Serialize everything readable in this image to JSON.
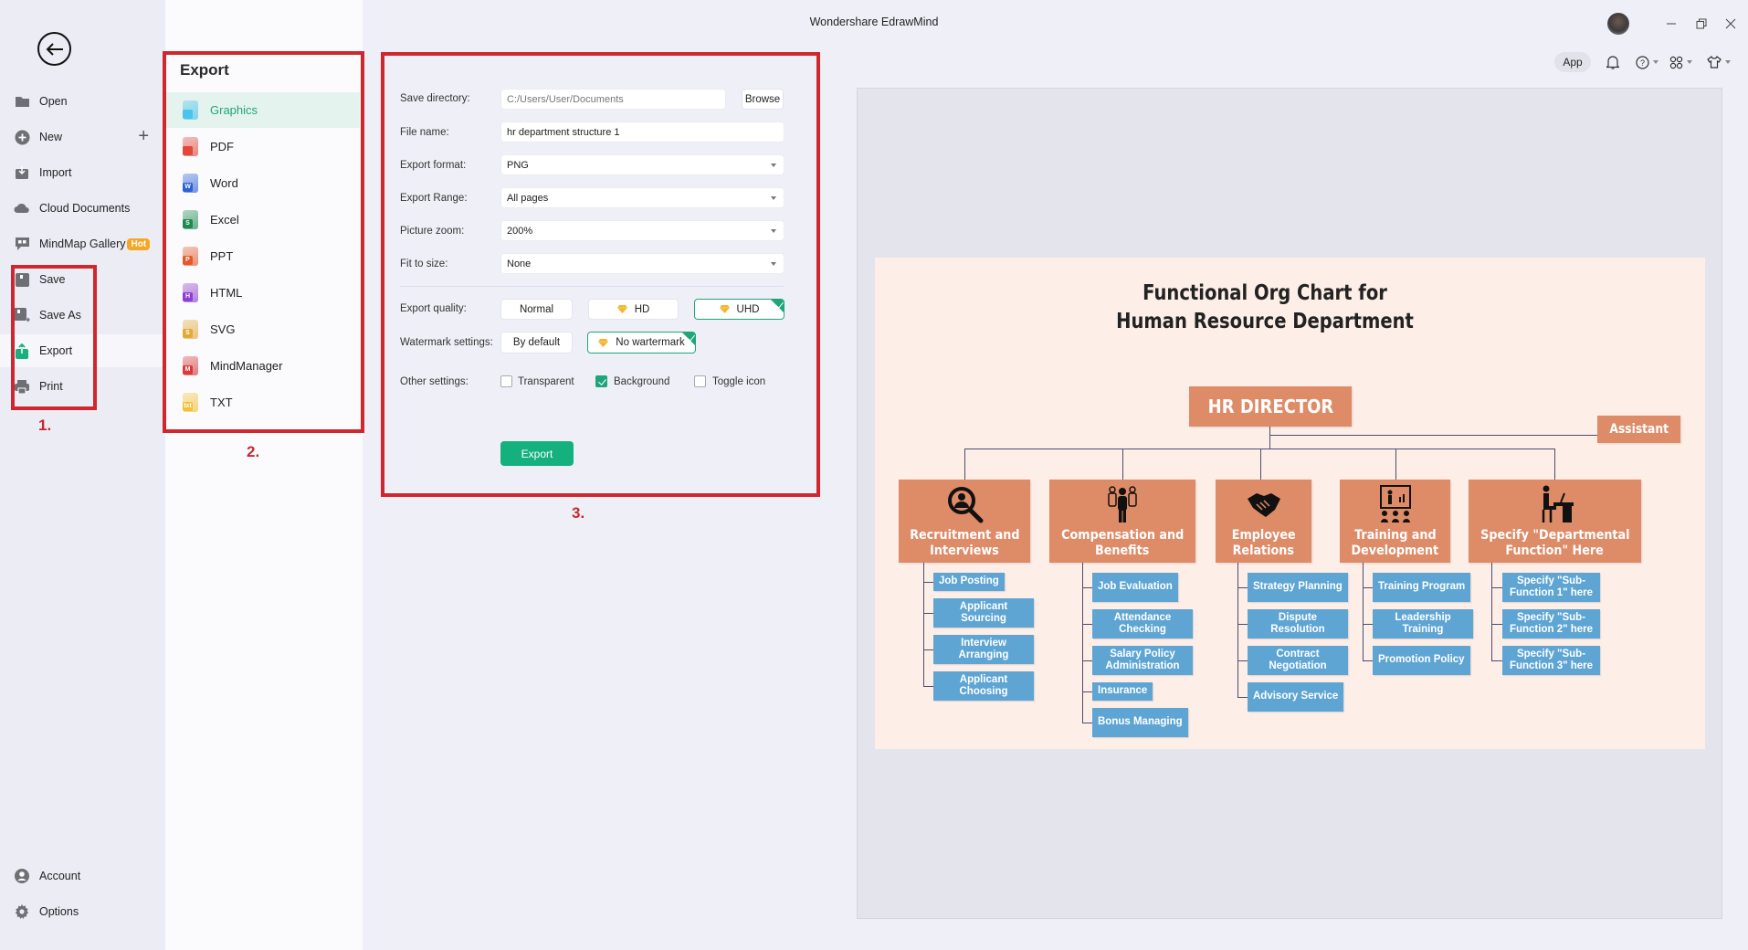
{
  "window": {
    "title": "Wondershare EdrawMind",
    "toolbar": {
      "app_label": "App"
    }
  },
  "sidebar": {
    "items": [
      {
        "label": "Open",
        "icon": "folder-icon"
      },
      {
        "label": "New",
        "icon": "plus-circle-icon"
      },
      {
        "label": "Import",
        "icon": "import-icon"
      },
      {
        "label": "Cloud Documents",
        "icon": "cloud-icon"
      },
      {
        "label": "MindMap Gallery",
        "icon": "gallery-icon",
        "badge": "Hot"
      },
      {
        "label": "Save",
        "icon": "save-icon"
      },
      {
        "label": "Save As",
        "icon": "save-as-icon"
      },
      {
        "label": "Export",
        "icon": "export-icon",
        "active": true
      },
      {
        "label": "Print",
        "icon": "print-icon"
      }
    ],
    "bottom": [
      {
        "label": "Account",
        "icon": "account-icon"
      },
      {
        "label": "Options",
        "icon": "gear-icon"
      }
    ]
  },
  "annotations": {
    "one": "1.",
    "two": "2.",
    "three": "3.",
    "accent": "#d0262e"
  },
  "export_panel": {
    "title": "Export",
    "formats": [
      {
        "label": "Graphics",
        "active": true,
        "color": "#4cc3ea",
        "glyph": ""
      },
      {
        "label": "PDF",
        "color": "#e2473a",
        "glyph": ""
      },
      {
        "label": "Word",
        "color": "#2d62d4",
        "glyph": "W"
      },
      {
        "label": "Excel",
        "color": "#1d8b50",
        "glyph": "S"
      },
      {
        "label": "PPT",
        "color": "#e55a2b",
        "glyph": "P"
      },
      {
        "label": "HTML",
        "color": "#8d3fd0",
        "glyph": "H"
      },
      {
        "label": "SVG",
        "color": "#e2a93b",
        "glyph": "S"
      },
      {
        "label": "MindManager",
        "color": "#d83a3a",
        "glyph": "M"
      },
      {
        "label": "TXT",
        "color": "#f2c13a",
        "glyph": "txt"
      }
    ]
  },
  "settings": {
    "save_directory": {
      "label": "Save directory:",
      "value": "C:/Users/User/Documents",
      "browse": "Browse"
    },
    "file_name": {
      "label": "File name:",
      "value": "hr department structure 1"
    },
    "export_format": {
      "label": "Export format:",
      "value": "PNG"
    },
    "export_range": {
      "label": "Export Range:",
      "value": "All pages"
    },
    "picture_zoom": {
      "label": "Picture zoom:",
      "value": "200%"
    },
    "fit_to_size": {
      "label": "Fit to size:",
      "value": "None"
    },
    "export_quality": {
      "label": "Export quality:",
      "options": [
        "Normal",
        "HD",
        "UHD"
      ],
      "selected": "UHD"
    },
    "watermark": {
      "label": "Watermark settings:",
      "options": [
        "By default",
        "No wartermark"
      ],
      "selected": "No wartermark"
    },
    "other": {
      "label": "Other settings:",
      "transparent": {
        "label": "Transparent",
        "checked": false
      },
      "background": {
        "label": "Background",
        "checked": true
      },
      "toggle_icon": {
        "label": "Toggle icon",
        "checked": false
      }
    },
    "export_button": "Export",
    "accent": "#14b07d"
  },
  "org_chart": {
    "title_line1": "Functional Org Chart for",
    "title_line2": "Human Resource Department",
    "director": "HR DIRECTOR",
    "assistant": "Assistant",
    "colors": {
      "dept": "#de8b68",
      "sub": "#5ea5d4",
      "canvas": "#fdeee8",
      "line": "#4a4e6e"
    },
    "departments": [
      {
        "line1": "Recruitment and",
        "line2": "Interviews",
        "icon": "magnifier-person-icon",
        "subs": [
          "Job Posting",
          "Applicant Sourcing",
          "Interview Arranging",
          "Applicant Choosing"
        ]
      },
      {
        "line1": "Compensation and",
        "line2": "Benefits",
        "icon": "group-people-icon",
        "subs": [
          "Job Evaluation",
          "Attendance Checking",
          "Salary Policy Administration",
          "Insurance",
          "Bonus Managing"
        ]
      },
      {
        "line1": "Employee",
        "line2": "Relations",
        "icon": "handshake-icon",
        "subs": [
          "Strategy Planning",
          "Dispute Resolution",
          "Contract Negotiation",
          "Advisory Service"
        ]
      },
      {
        "line1": "Training and",
        "line2": "Development",
        "icon": "presentation-icon",
        "subs": [
          "Training Program",
          "Leadership Training",
          "Promotion Policy"
        ]
      },
      {
        "line1": "Specify \"Departmental",
        "line2": "Function\" Here",
        "icon": "desk-worker-icon",
        "subs": [
          "Specify \"Sub-Function 1\" here",
          "Specify \"Sub-Function 2\" here",
          "Specify \"Sub-Function 3\" here"
        ]
      }
    ]
  }
}
